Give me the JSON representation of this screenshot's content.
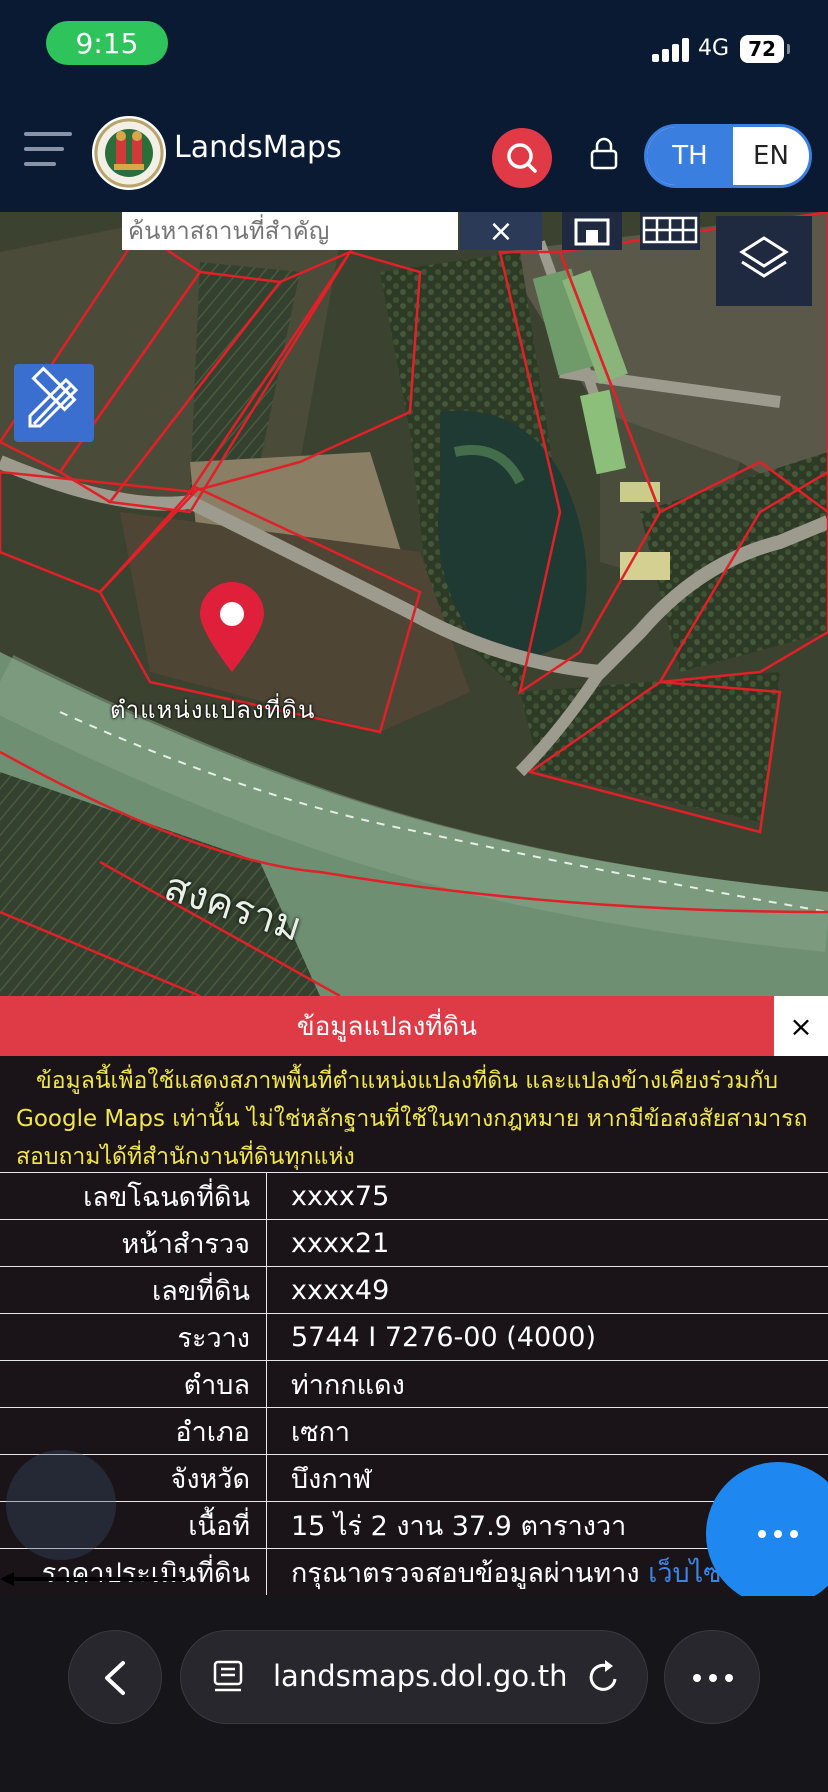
{
  "status_bar": {
    "time": "9:15",
    "network": "4G",
    "battery": "72"
  },
  "header": {
    "title": "LandsMaps",
    "lang_th": "TH",
    "lang_en": "EN"
  },
  "map": {
    "search_placeholder": "ค้นหาสถานที่สำคัญ",
    "clear_label": "×",
    "parcel_label": "ตำแหน่งแปลงที่ดิน",
    "river_label": "สงคราม"
  },
  "panel": {
    "title": "ข้อมูลแปลงที่ดิน",
    "close_label": "×",
    "disclaimer": "ข้อมูลนี้เพื่อใช้แสดงสภาพพื้นที่ตำแหน่งแปลงที่ดิน และแปลงข้างเคียงร่วมกับ Google Maps เท่านั้น ไม่ใช่หลักฐานที่ใช้ในทางกฎหมาย หากมีข้อสงสัยสามารถสอบถามได้ที่สำนักงานที่ดินทุกแห่ง",
    "rows": [
      {
        "label": "เลขโฉนดที่ดิน",
        "value": "xxxx75"
      },
      {
        "label": "หน้าสำรวจ",
        "value": "xxxx21"
      },
      {
        "label": "เลขที่ดิน",
        "value": "xxxx49"
      },
      {
        "label": "ระวาง",
        "value": "5744 I 7276-00 (4000)"
      },
      {
        "label": "ตำบล",
        "value": "ท่ากกแดง"
      },
      {
        "label": "อำเภอ",
        "value": "เซกา"
      },
      {
        "label": "จังหวัด",
        "value": "บึงกาฬ"
      },
      {
        "label": "เนื้อที่",
        "value": "15 ไร่ 2 งาน 37.9 ตารางวา"
      },
      {
        "label": "ราคาประเมินที่ดิน",
        "value": "กรุณาตรวจสอบข้อมูลผ่านทาง",
        "link": "เว็บไซต์กรม"
      }
    ]
  },
  "browser": {
    "url": "landsmaps.dol.go.th"
  },
  "colors": {
    "header_bg": "#0b1a33",
    "accent_red": "#df3b47",
    "accent_blue": "#3a7ee0",
    "disclaimer_yellow": "#f2e74a"
  }
}
